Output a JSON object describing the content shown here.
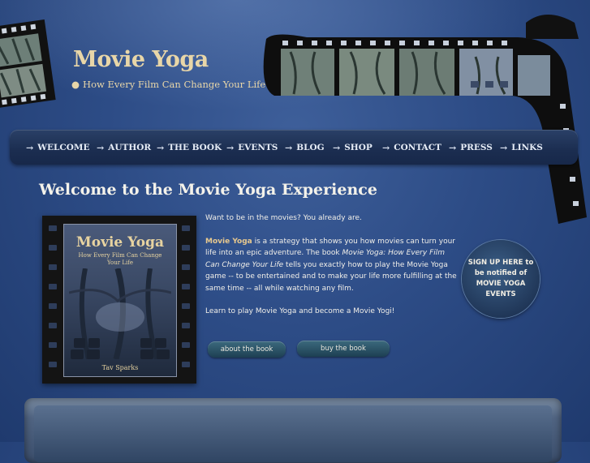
{
  "header": {
    "title": "Movie Yoga",
    "tagline_bullet": "●",
    "tagline": "How Every Film Can Change Your Life"
  },
  "nav": {
    "arrow_glyph": "→",
    "items": [
      {
        "label": "WELCOME"
      },
      {
        "label": "AUTHOR"
      },
      {
        "label": "THE BOOK"
      },
      {
        "label": "EVENTS"
      },
      {
        "label": "BLOG"
      },
      {
        "label": "SHOP"
      },
      {
        "label": "CONTACT"
      },
      {
        "label": "PRESS"
      },
      {
        "label": "LINKS"
      }
    ]
  },
  "main": {
    "heading": "Welcome to the Movie Yoga Experience",
    "intro_line": "Want to be in the movies? You already are.",
    "desc_strong": "Movie Yoga",
    "desc_part1": " is a strategy that shows you how movies can turn your life into an epic adventure.  The book ",
    "desc_book_title": "Movie Yoga: How Every Film Can Change Your Life",
    "desc_part2": " tells you exactly how to play the Movie Yoga game -- to be entertained and to make your life more fulfilling at the same time -- all while watching any film.",
    "learn_line": "Learn to play Movie Yoga and become a Movie Yogi!",
    "about_button": "about the book",
    "buy_button": "buy the book"
  },
  "book": {
    "title": "Movie Yoga",
    "subtitle": "How Every Film Can Change Your Life",
    "author": "Tav Sparks"
  },
  "signup": {
    "text": "SIGN UP HERE to be notified of MOVIE YOGA EVENTS"
  },
  "colors": {
    "background": "#2d4c86",
    "accent_gold": "#e8d6a8",
    "nav_bg": "#1b2d50"
  }
}
